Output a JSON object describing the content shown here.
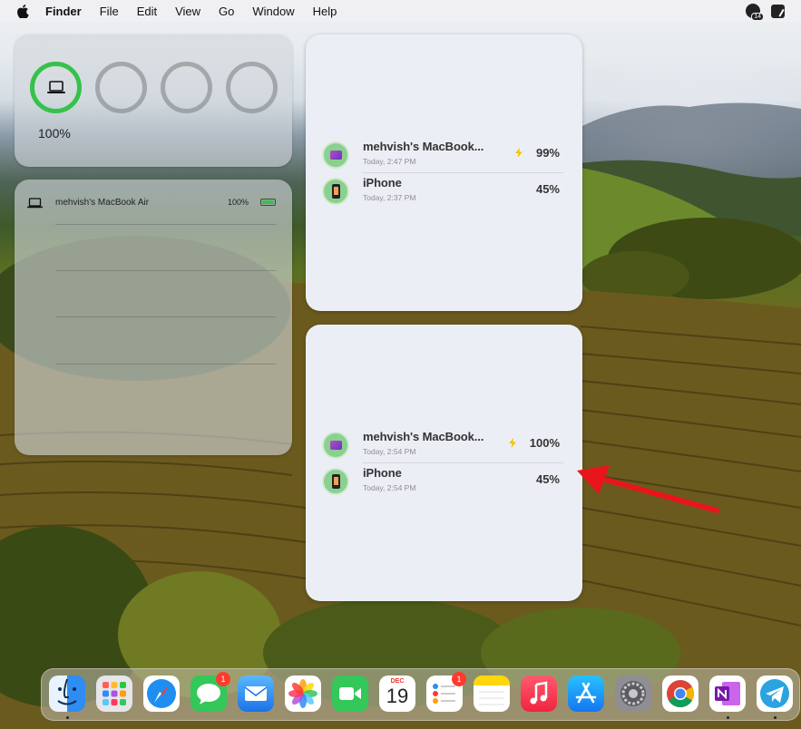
{
  "menubar": {
    "items": [
      "Finder",
      "File",
      "Edit",
      "View",
      "Go",
      "Window",
      "Help"
    ],
    "notification_count": "14"
  },
  "widget_rings": {
    "percent": "100%"
  },
  "widget_list": {
    "device_name": "mehvish's MacBook Air",
    "percent": "100%"
  },
  "widget_devices_1": {
    "rows": [
      {
        "name": "mehvish's MacBook...",
        "time": "Today, 2:47 PM",
        "percent": "99%",
        "charging": true
      },
      {
        "name": "iPhone",
        "time": "Today, 2:37 PM",
        "percent": "45%",
        "charging": false
      }
    ]
  },
  "widget_devices_2": {
    "rows": [
      {
        "name": "mehvish's MacBook...",
        "time": "Today, 2:54 PM",
        "percent": "100%",
        "charging": true
      },
      {
        "name": "iPhone",
        "time": "Today, 2:54 PM",
        "percent": "45%",
        "charging": false
      }
    ]
  },
  "dock": {
    "apps": [
      {
        "name": "Finder",
        "icon": "finder-icon"
      },
      {
        "name": "Launchpad",
        "icon": "launchpad-icon"
      },
      {
        "name": "Safari",
        "icon": "safari-icon"
      },
      {
        "name": "Messages",
        "icon": "messages-icon",
        "badge": "1"
      },
      {
        "name": "Mail",
        "icon": "mail-icon"
      },
      {
        "name": "Photos",
        "icon": "photos-icon"
      },
      {
        "name": "FaceTime",
        "icon": "facetime-icon"
      },
      {
        "name": "Calendar",
        "icon": "calendar-icon",
        "month": "DEC",
        "day": "19"
      },
      {
        "name": "Reminders",
        "icon": "reminders-icon",
        "badge": "1"
      },
      {
        "name": "Notes",
        "icon": "notes-icon"
      },
      {
        "name": "Music",
        "icon": "music-icon"
      },
      {
        "name": "App Store",
        "icon": "app-store-icon"
      },
      {
        "name": "System Settings",
        "icon": "settings-icon"
      },
      {
        "name": "Chrome",
        "icon": "chrome-icon"
      },
      {
        "name": "OneNote",
        "icon": "onenote-icon"
      },
      {
        "name": "Telegram",
        "icon": "telegram-icon"
      }
    ]
  },
  "colors": {
    "charge_green": "#35c24a",
    "bolt_yellow": "#f5c400",
    "arrow_red": "#e8151b",
    "badge_red": "#ff3b30"
  }
}
